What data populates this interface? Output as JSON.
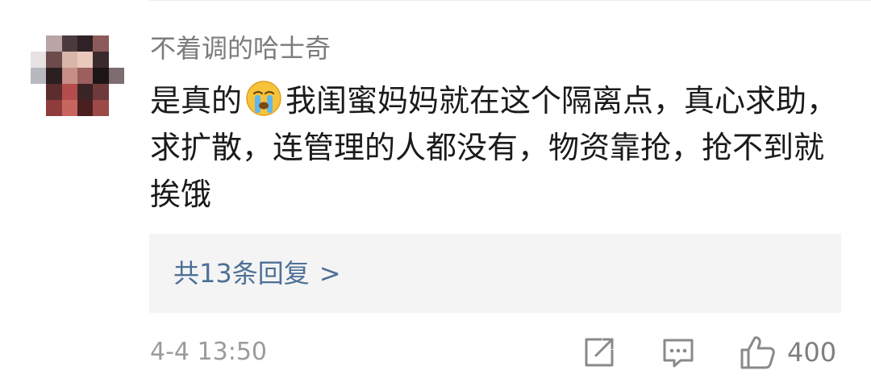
{
  "comment": {
    "username": "不着调的哈士奇",
    "text_before_emoji": "是真的",
    "emoji_icon": "crying-face-icon",
    "text_after_emoji": "我闺蜜妈妈就在这个隔离点，真心求助，求扩散，连管理的人都没有，物资靠抢，抢不到就挨饿",
    "replies_label": "共13条回复",
    "replies_chevron": ">",
    "timestamp": "4-4 13:50",
    "like_count": "400"
  },
  "actions": {
    "share_icon": "share-icon",
    "reply_icon": "comment-bubble-icon",
    "like_icon": "thumbs-up-icon"
  },
  "colors": {
    "username": "#7c7c7c",
    "body_text": "#1a1a1a",
    "link": "#4d7096",
    "meta": "#9b9b9b",
    "reply_box_bg": "#f4f4f4"
  }
}
